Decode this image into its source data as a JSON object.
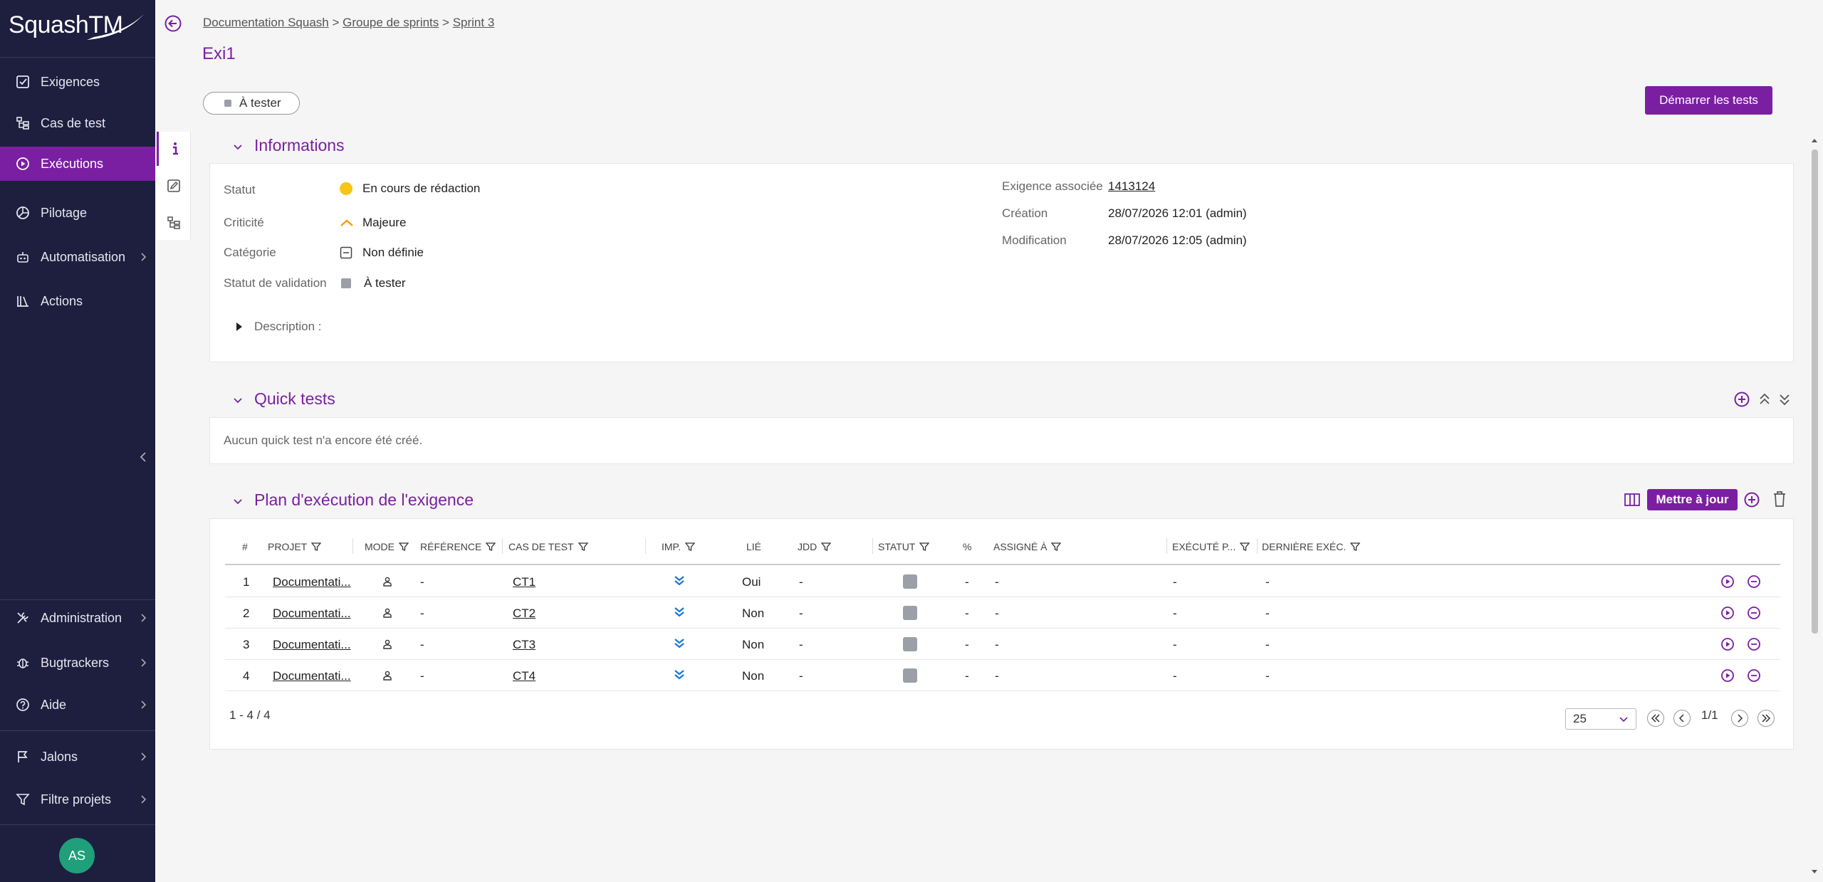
{
  "app": {
    "logo_text": "SquashTM"
  },
  "sidebar": {
    "items": [
      {
        "label": "Exigences",
        "icon": "checkbox-icon"
      },
      {
        "label": "Cas de test",
        "icon": "tree-icon"
      },
      {
        "label": "Exécutions",
        "icon": "play-circle-icon",
        "active": true
      },
      {
        "label": "Pilotage",
        "icon": "pie-chart-icon"
      },
      {
        "label": "Automatisation",
        "icon": "robot-icon"
      },
      {
        "label": "Actions",
        "icon": "books-icon"
      }
    ],
    "bottom_items": [
      {
        "label": "Administration",
        "icon": "tools-icon"
      },
      {
        "label": "Bugtrackers",
        "icon": "bug-icon"
      },
      {
        "label": "Aide",
        "icon": "help-icon"
      },
      {
        "label": "Jalons",
        "icon": "flag-icon"
      },
      {
        "label": "Filtre projets",
        "icon": "filter-icon"
      }
    ],
    "avatar": "AS"
  },
  "header": {
    "breadcrumb": [
      "Documentation Squash",
      "Groupe de sprints",
      "Sprint 3"
    ],
    "breadcrumb_sep": ">",
    "title": "Exi1",
    "status_pill": "À tester",
    "start_button": "Démarrer les tests"
  },
  "informations": {
    "title": "Informations",
    "statut_label": "Statut",
    "statut_value": "En cours de rédaction",
    "criticite_label": "Criticité",
    "criticite_value": "Majeure",
    "categorie_label": "Catégorie",
    "categorie_value": "Non définie",
    "validation_label": "Statut de validation",
    "validation_value": "À tester",
    "exigence_label": "Exigence associée",
    "exigence_value": "1413124",
    "creation_label": "Création",
    "creation_value": "28/07/2026 12:01 (admin)",
    "modification_label": "Modification",
    "modification_value": "28/07/2026 12:05 (admin)",
    "description_label": "Description :"
  },
  "quick_tests": {
    "title": "Quick tests",
    "empty": "Aucun quick test n'a encore été créé."
  },
  "plan": {
    "title": "Plan d'exécution de l'exigence",
    "update_button": "Mettre à jour",
    "columns": {
      "num": "#",
      "projet": "PROJET",
      "mode": "MODE",
      "reference": "RÉFÉRENCE",
      "cas": "CAS DE TEST",
      "imp": "IMP.",
      "lie": "LIÉ",
      "jdd": "JDD",
      "statut": "STATUT",
      "pct": "%",
      "assigne": "ASSIGNÉ À",
      "execute": "EXÉCUTÉ P...",
      "derniere": "DERNIÈRE EXÉC."
    },
    "rows": [
      {
        "num": "1",
        "projet": "Documentati...",
        "reference": "-",
        "cas": "CT1",
        "lie": "Oui",
        "jdd": "-",
        "pct": "-",
        "assigne": "-",
        "execute": "-",
        "derniere": "-"
      },
      {
        "num": "2",
        "projet": "Documentati...",
        "reference": "-",
        "cas": "CT2",
        "lie": "Non",
        "jdd": "-",
        "pct": "-",
        "assigne": "-",
        "execute": "-",
        "derniere": "-"
      },
      {
        "num": "3",
        "projet": "Documentati...",
        "reference": "-",
        "cas": "CT3",
        "lie": "Non",
        "jdd": "-",
        "pct": "-",
        "assigne": "-",
        "execute": "-",
        "derniere": "-"
      },
      {
        "num": "4",
        "projet": "Documentati...",
        "reference": "-",
        "cas": "CT4",
        "lie": "Non",
        "jdd": "-",
        "pct": "-",
        "assigne": "-",
        "execute": "-",
        "derniere": "-"
      }
    ],
    "count": "1 - 4 / 4",
    "page_size": "25",
    "page": "1/1"
  },
  "colors": {
    "accent": "#7b1fa2",
    "sidebar": "#1e1e3f",
    "imp_low": "#1976d2",
    "criticite": "#f59e0b"
  }
}
